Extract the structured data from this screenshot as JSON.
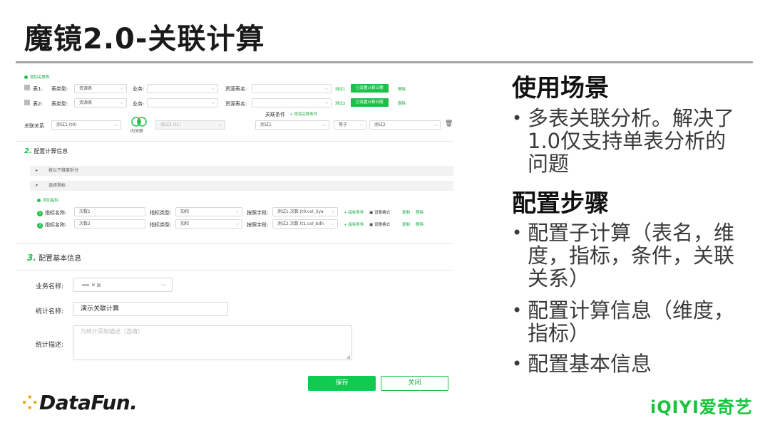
{
  "slide": {
    "title": "魔镜2.0-关联计算"
  },
  "right": {
    "h1": "使用场景",
    "b1_l1": "多表关联分析。解决了",
    "b1_l2": "1.0仅支持单表分析的",
    "b1_l3": "问题",
    "h2": "配置步骤",
    "b2_l1": "配置子计算（表名，维",
    "b2_l2": "度，指标，条件，关联",
    "b2_l3": "关系）",
    "b3_l1": "配置计算信息（维度，",
    "b3_l2": "指标）",
    "b4_l1": "配置基本信息"
  },
  "section1": {
    "add_table": "增加关联表",
    "t1_label": "表1:",
    "t2_label": "表2:",
    "table_type_label": "表类型:",
    "table_type_value": "资源表",
    "business_label": "业务:",
    "table_name_label": "资源表名:",
    "test1": "测试1",
    "test2": "测试2",
    "set_subcalc_btn": "已设置计算日期",
    "delete": "删除",
    "join_condition_label": "关联条件",
    "add_join_condition": "增加关联条件",
    "relation_label": "关联关系",
    "left_select": "测试1 (t0)",
    "inner_join": "内关联",
    "right_select": "测试2 (t1)",
    "cond_left": "测试1",
    "cond_op": "等于",
    "cond_right": "测试2"
  },
  "section2": {
    "num": "2.",
    "title": "配置计算信息",
    "by_dimension": "按以下维度拆分",
    "select_metric": "选择指标",
    "add_metric": "添加指标",
    "metric_name_label": "指标名称:",
    "m1_name": "次数1",
    "m2_name": "次数2",
    "metric_type_label": "指标类型:",
    "metric_type_value": "加和",
    "by_field_label": "按照字段:",
    "m1_field": "测试1.次数 (t0.col_3ya",
    "m2_field": "测试2.次数 (t1.col_bdh",
    "metric_condition": "指标条件",
    "set_format": "设置格式",
    "copy": "复制",
    "delete": "删除"
  },
  "section3": {
    "num": "3.",
    "title": "配置基本信息",
    "business_name_label": "业务名称:",
    "stat_name_label": "统计名称:",
    "stat_name_value": "演示关联计算",
    "stat_desc_label": "统计描述:",
    "stat_desc_placeholder": "为统计添加描述（选填）"
  },
  "buttons": {
    "save": "保存",
    "close": "关闭"
  },
  "logos": {
    "datafun": "DataFun.",
    "iqiyi": "iQIYI爱奇艺"
  },
  "colors": {
    "accent_green": "#1ec04c",
    "logo_orange": "#f5a623",
    "iqiyi_green": "#19c33d"
  }
}
